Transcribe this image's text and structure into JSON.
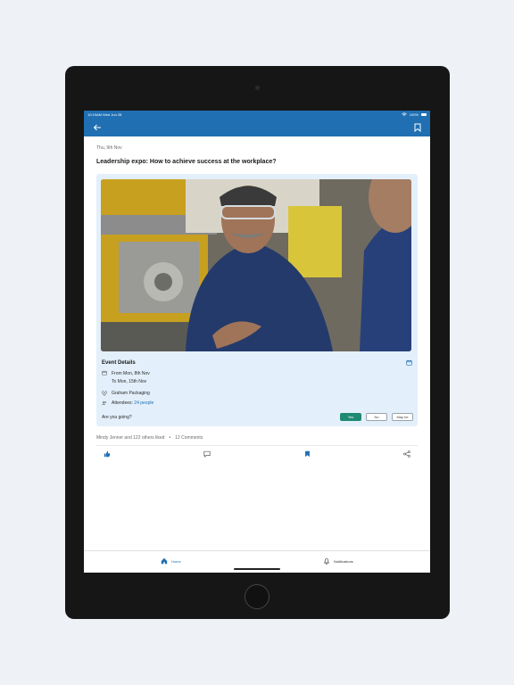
{
  "status": {
    "left": "10:19AM Wed Jun 28",
    "battery": "100%"
  },
  "post": {
    "date": "Thu, 9th Nov",
    "title": "Leadership expo: How to achieve success at the workplace?"
  },
  "event": {
    "section_label": "Event Details",
    "date_from": "From Mon, 8th Nov",
    "date_to": "To Mon, 15th Nov",
    "location": "Graham Packaging",
    "attendees_label": "Attendees:",
    "attendees_count": "24 people",
    "rsvp_question": "Are you going?",
    "rsvp_options": [
      "Yes",
      "No",
      "May be"
    ],
    "rsvp_selected": "Yes"
  },
  "engagement": {
    "likes": "Mindy Jenner and 122 others liked",
    "comments": "12 Comments"
  },
  "nav": {
    "home": "Home",
    "notifications": "Notifications"
  },
  "colors": {
    "accent": "#1f6fb2",
    "rsvp_yes": "#1f8a72",
    "card_bg": "#e3f0fb"
  }
}
